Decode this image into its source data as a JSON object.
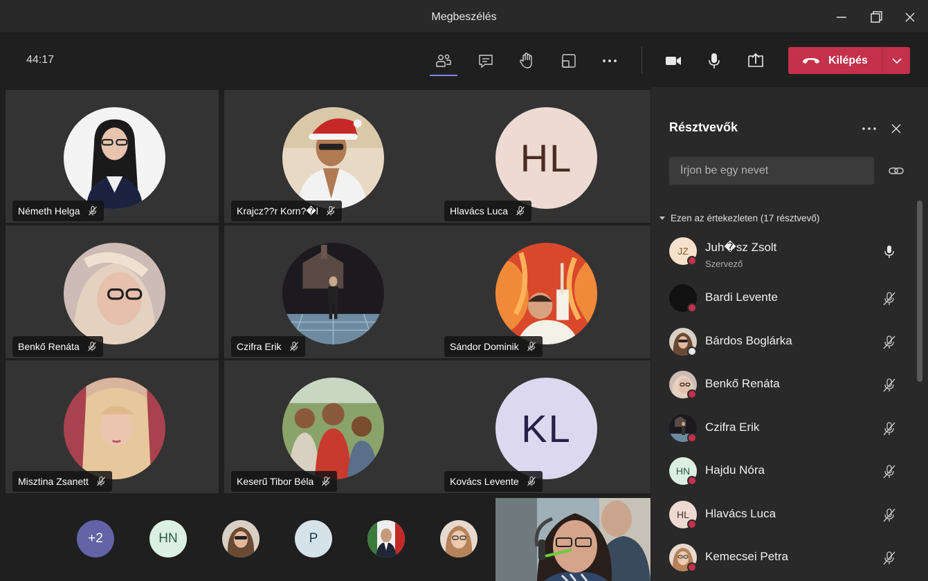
{
  "window": {
    "title": "Megbeszélés"
  },
  "toolbar": {
    "timer": "44:17",
    "leave_label": "Kilépés"
  },
  "tiles": [
    {
      "name": "Németh Helga"
    },
    {
      "name": "Krajcz??r Korn?�l"
    },
    {
      "name": "Hlavács Luca",
      "initials": "HL"
    },
    {
      "name": "Benkő Renáta"
    },
    {
      "name": "Czifra Erik"
    },
    {
      "name": "Sándor Dominik"
    },
    {
      "name": "Misztina Zsanett"
    },
    {
      "name": "Keserű Tibor Béla"
    },
    {
      "name": "Kovács Levente",
      "initials": "KL"
    }
  ],
  "bottom_row": {
    "overflow_count": "+2",
    "avatars": [
      "HN",
      "P"
    ]
  },
  "panel": {
    "title": "Résztvevők",
    "search_placeholder": "Írjon be egy nevet",
    "section_label": "Ezen az értekezleten (17 résztvevő)",
    "participants": [
      {
        "name": "Juh�sz Zsolt",
        "role": "Szervező",
        "initials": "JZ",
        "mic": "on"
      },
      {
        "name": "Bardi Levente",
        "mic": "muted"
      },
      {
        "name": "Bárdos Boglárka",
        "mic": "muted"
      },
      {
        "name": "Benkő Renáta",
        "mic": "muted"
      },
      {
        "name": "Czifra Erik",
        "mic": "muted"
      },
      {
        "name": "Hajdu Nóra",
        "initials": "HN",
        "mic": "muted"
      },
      {
        "name": "Hlavács Luca",
        "initials": "HL",
        "mic": "muted"
      },
      {
        "name": "Kemecsei Petra",
        "mic": "muted"
      }
    ]
  },
  "colors": {
    "leave": "#c4314b",
    "accent": "#7f85f5",
    "tile_bg": "#333333",
    "panel_bg": "#292929"
  }
}
